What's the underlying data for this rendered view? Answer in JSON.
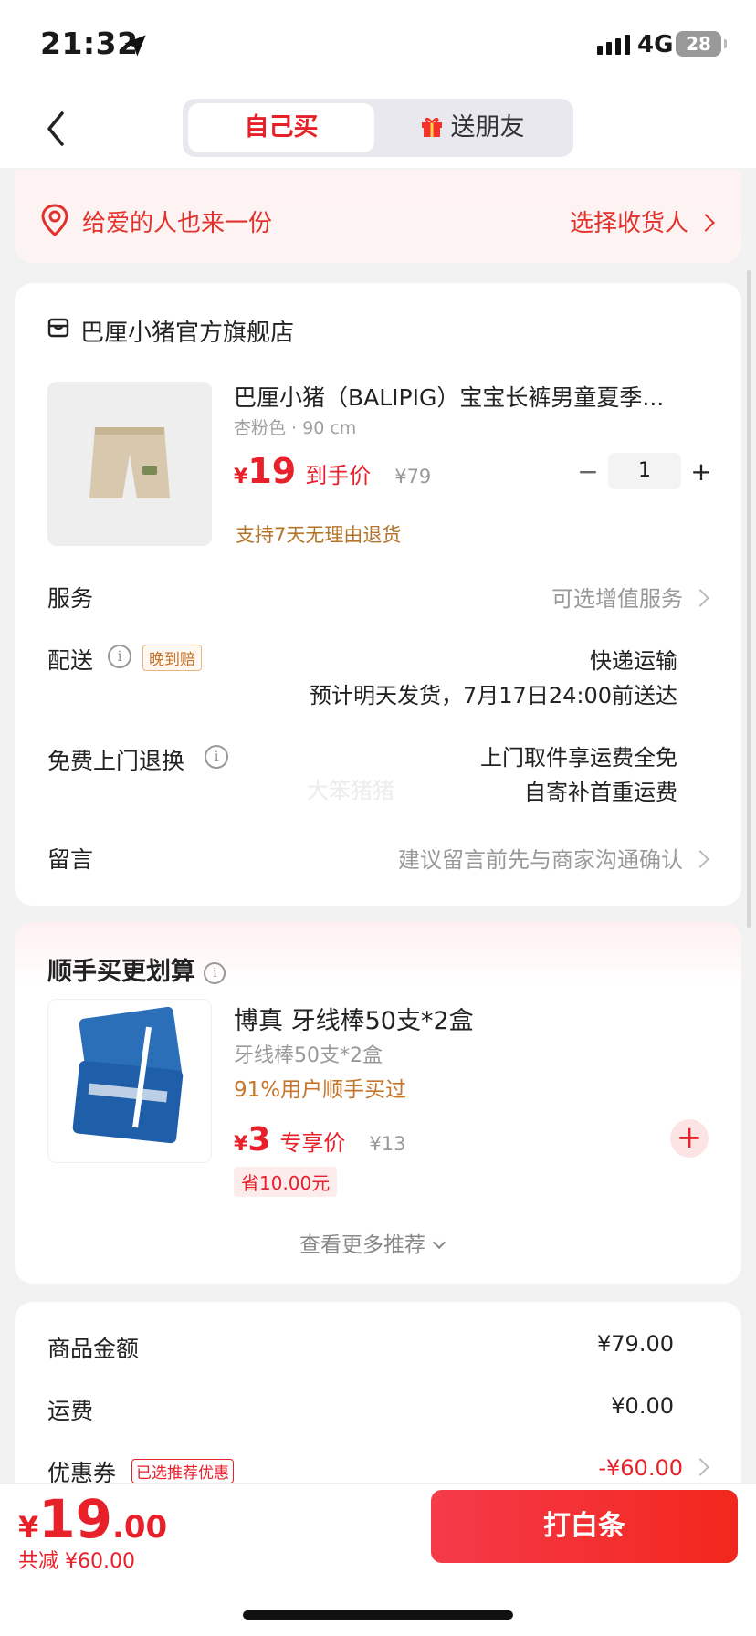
{
  "status_bar": {
    "time": "21:32",
    "network": "4G",
    "battery": "28"
  },
  "header": {
    "tab_self": "自己买",
    "tab_gift": "送朋友"
  },
  "gift_banner": {
    "text": "给爱的人也来一份",
    "action": "选择收货人"
  },
  "store": {
    "name": "巴厘小猪官方旗舰店"
  },
  "product": {
    "title": "巴厘小猪（BALIPIG）宝宝长裤男童夏季...",
    "spec": "杏粉色 · 90 cm",
    "yen": "¥",
    "price": "19",
    "price_label": "到手价",
    "original_price": "¥79",
    "quantity": "1",
    "return_policy": "支持7天无理由退货"
  },
  "service": {
    "label": "服务",
    "value": "可选增值服务"
  },
  "delivery": {
    "label": "配送",
    "tag": "晚到赔",
    "method": "快递运输",
    "eta": "预计明天发货，7月17日24:00前送达"
  },
  "pickup": {
    "label": "免费上门退换",
    "line1": "上门取件享运费全免",
    "line2": "自寄补首重运费"
  },
  "watermark": "大笨猪猪",
  "message": {
    "label": "留言",
    "placeholder": "建议留言前先与商家沟通确认"
  },
  "addon": {
    "title": "顺手买更划算",
    "name": "博真 牙线棒50支*2盒",
    "spec": "牙线棒50支*2盒",
    "bought": "91%用户顺手买过",
    "yen": "¥",
    "price": "3",
    "price_label": "专享价",
    "original_price": "¥13",
    "save": "省10.00元",
    "more": "查看更多推荐"
  },
  "summary": {
    "goods_label": "商品金额",
    "goods_value": "¥79.00",
    "freight_label": "运费",
    "freight_value": "¥0.00",
    "coupon_label": "优惠券",
    "coupon_tag": "已选推荐优惠",
    "coupon_value": "-¥60.00"
  },
  "bottom": {
    "yen": "¥",
    "total_int": "19",
    "total_dec": ".00",
    "reduced": "共减 ¥60.00",
    "pay_button": "打白条"
  },
  "colors": {
    "accent": "#e8202a",
    "gold": "#c5742a"
  }
}
